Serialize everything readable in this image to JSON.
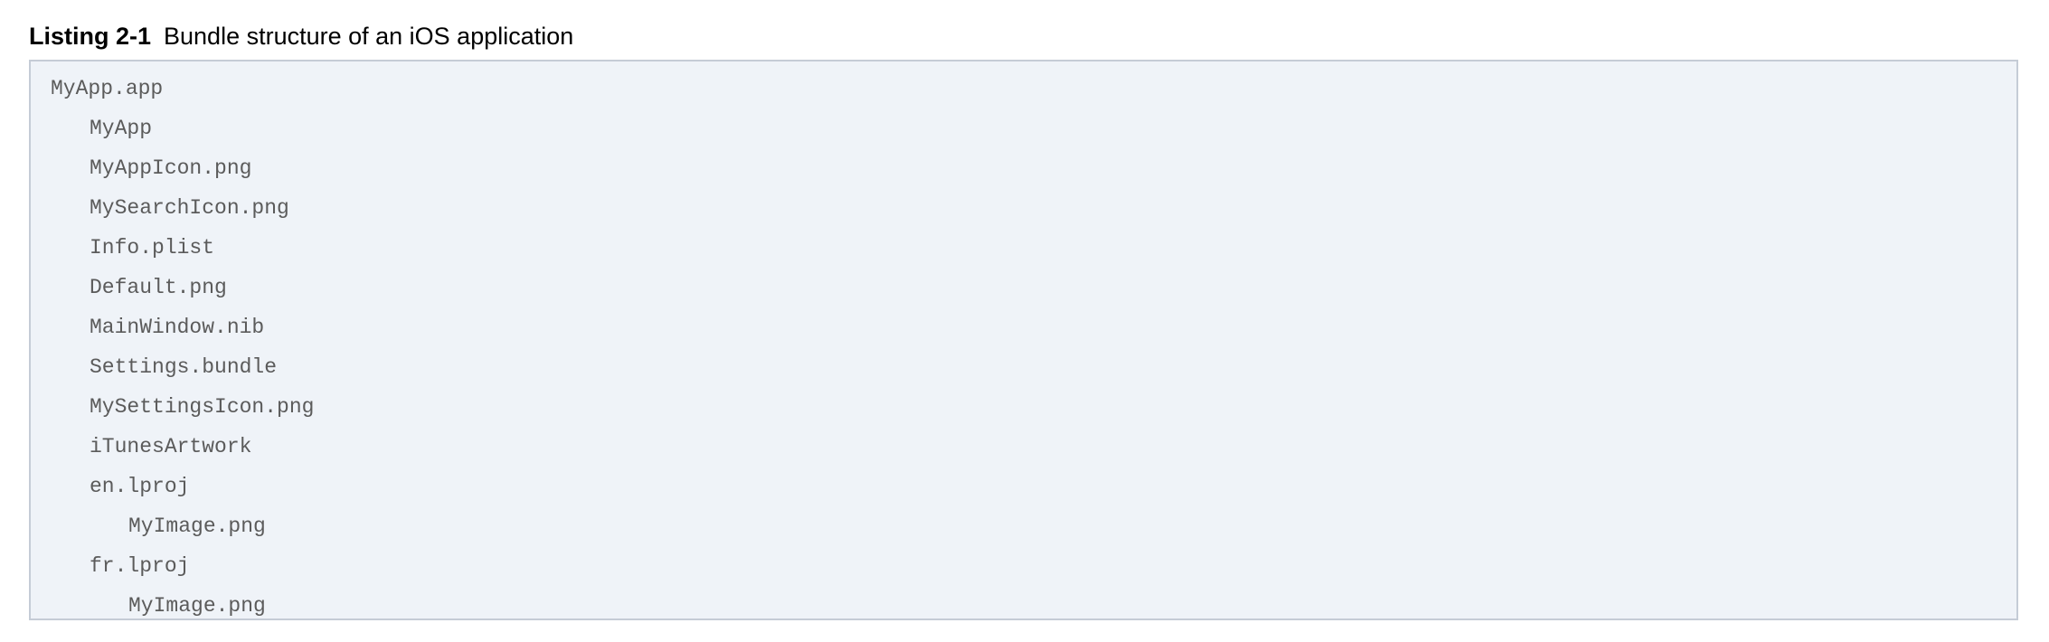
{
  "listing": {
    "label": "Listing 2-1",
    "title": "Bundle structure of an iOS application",
    "lines": [
      {
        "text": "MyApp.app",
        "level": 0
      },
      {
        "text": "MyApp",
        "level": 1
      },
      {
        "text": "MyAppIcon.png",
        "level": 1
      },
      {
        "text": "MySearchIcon.png",
        "level": 1
      },
      {
        "text": "Info.plist",
        "level": 1
      },
      {
        "text": "Default.png",
        "level": 1
      },
      {
        "text": "MainWindow.nib",
        "level": 1
      },
      {
        "text": "Settings.bundle",
        "level": 1
      },
      {
        "text": "MySettingsIcon.png",
        "level": 1
      },
      {
        "text": "iTunesArtwork",
        "level": 1
      },
      {
        "text": "en.lproj",
        "level": 1
      },
      {
        "text": "MyImage.png",
        "level": 2
      },
      {
        "text": "fr.lproj",
        "level": 1
      },
      {
        "text": "MyImage.png",
        "level": 2
      }
    ]
  },
  "colors": {
    "code_background": "#eff3f8",
    "code_border": "#c5ccd6",
    "code_text": "#5b5b5b",
    "caption_text": "#000000"
  }
}
